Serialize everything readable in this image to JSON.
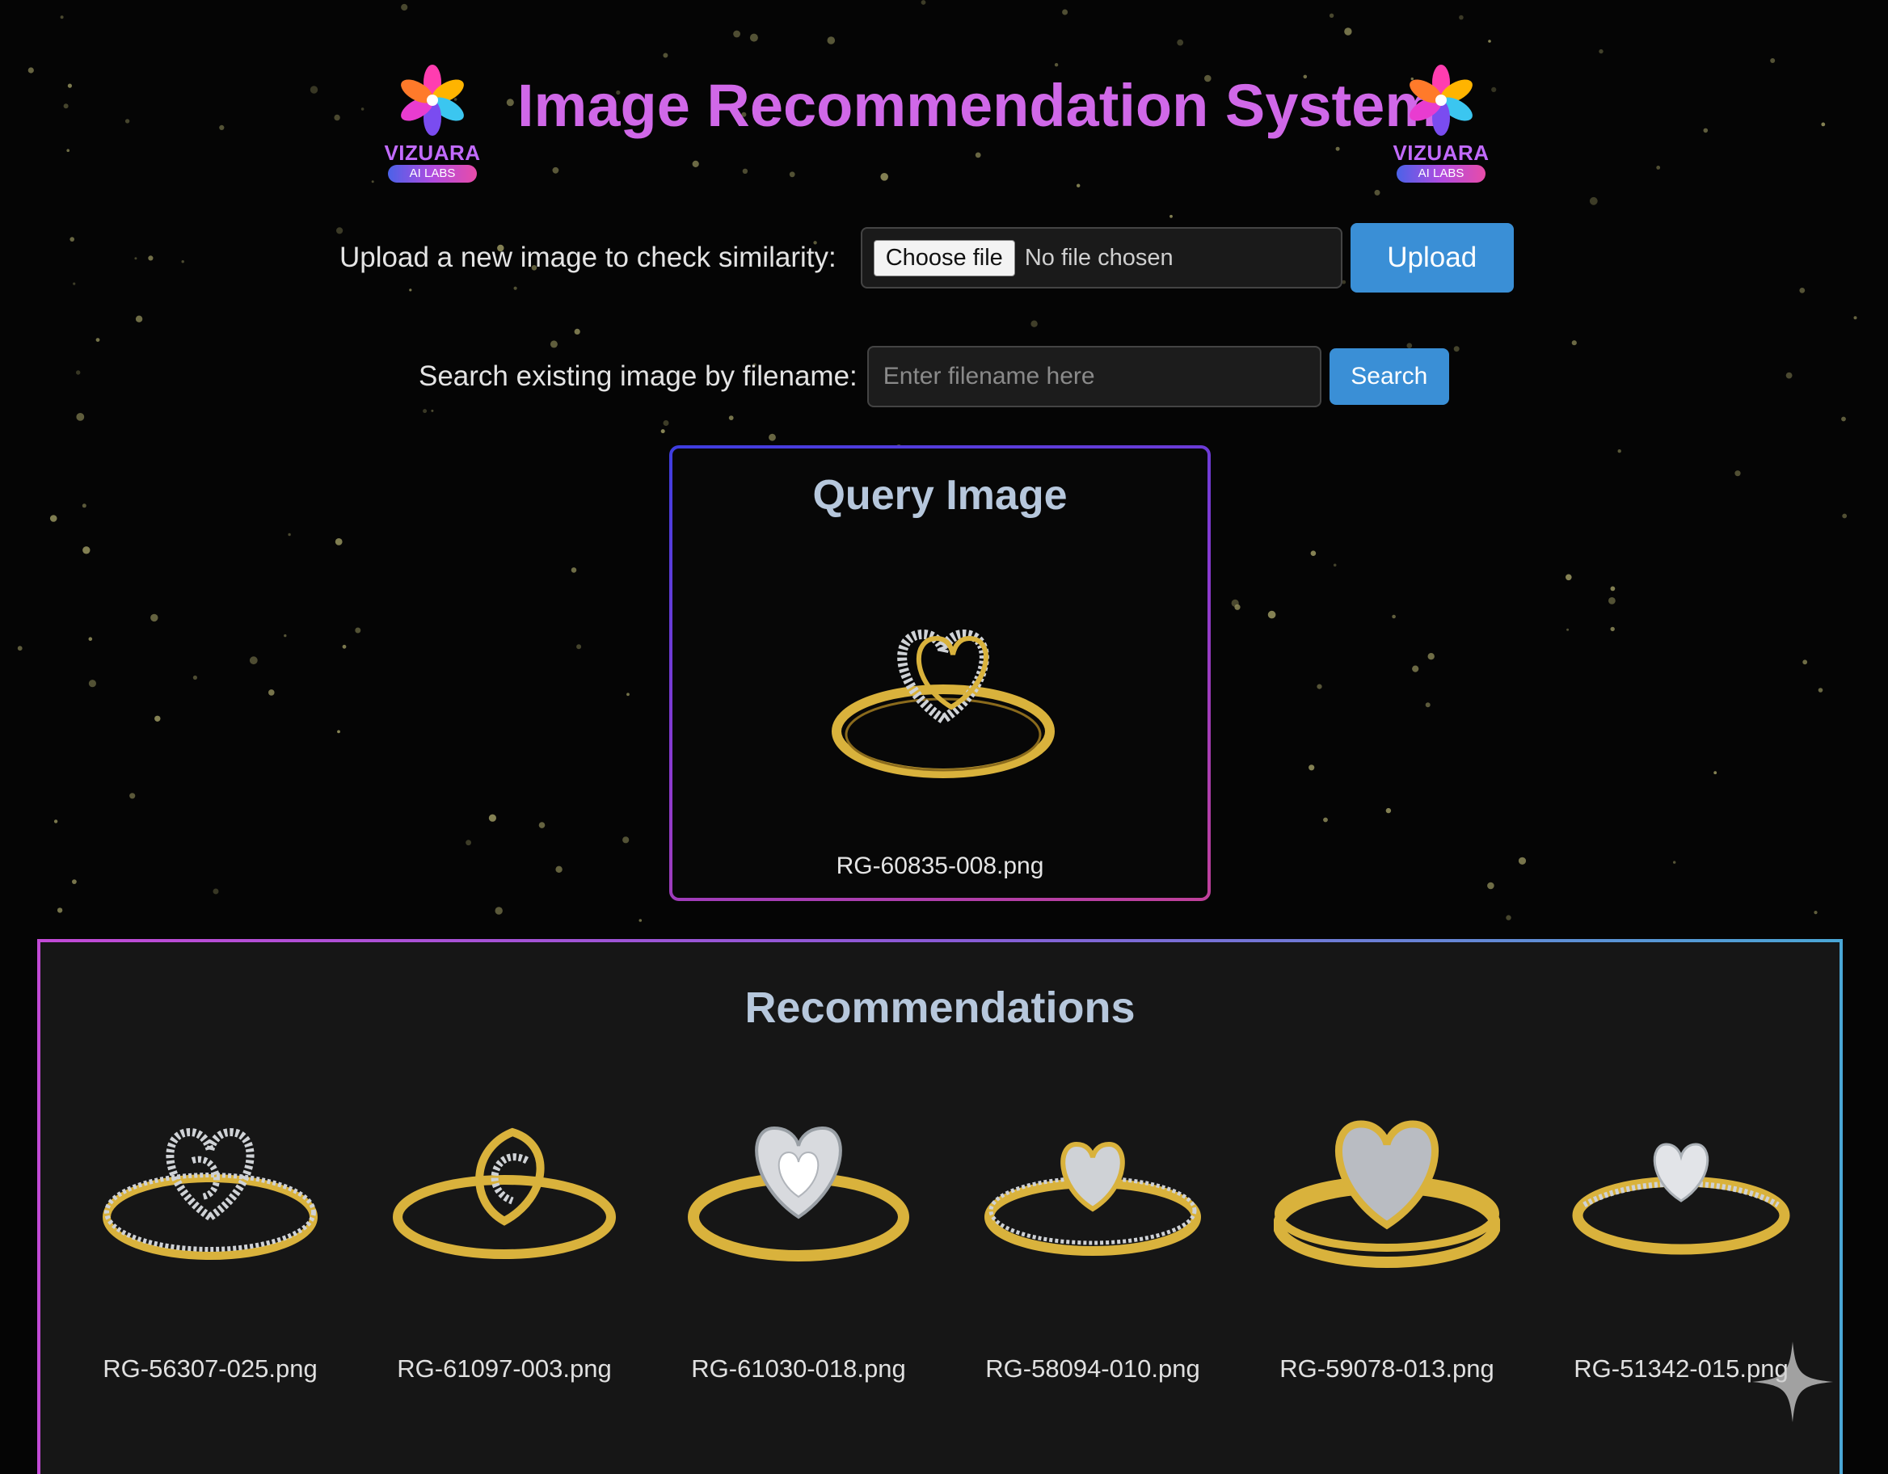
{
  "header": {
    "title": "Image Recommendation System",
    "logo_word": "VIZUARA",
    "logo_tagline": "AI LABS"
  },
  "upload": {
    "label": "Upload a new image to check similarity:",
    "choose_file_label": "Choose file",
    "file_status": "No file chosen",
    "button_label": "Upload"
  },
  "search": {
    "label": "Search existing image by filename:",
    "placeholder": "Enter filename here",
    "button_label": "Search"
  },
  "query": {
    "title": "Query Image",
    "filename": "RG-60835-008.png"
  },
  "recommendations": {
    "title": "Recommendations",
    "items": [
      {
        "filename": "RG-56307-025.png"
      },
      {
        "filename": "RG-61097-003.png"
      },
      {
        "filename": "RG-61030-018.png"
      },
      {
        "filename": "RG-58094-010.png"
      },
      {
        "filename": "RG-59078-013.png"
      },
      {
        "filename": "RG-51342-015.png"
      }
    ]
  },
  "colors": {
    "title": "#d068e8",
    "button": "#3a8fd6",
    "gold": "#d9b23c",
    "section_heading": "#b6c7dc"
  }
}
